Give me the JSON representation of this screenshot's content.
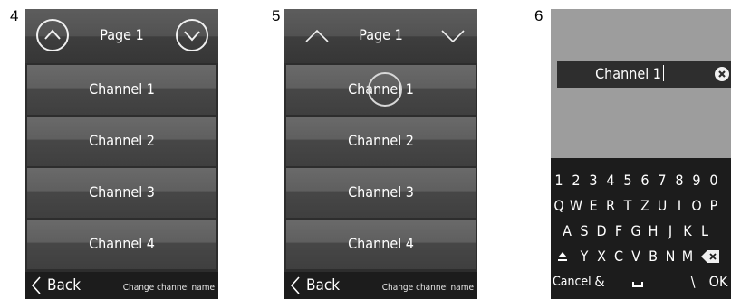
{
  "steps": {
    "first": "4",
    "second": "5",
    "third": "6"
  },
  "channel_screen": {
    "page_title": "Page 1",
    "channels": [
      "Channel 1",
      "Channel 2",
      "Channel 3",
      "Channel 4"
    ],
    "back_label": "Back",
    "footer_hint": "Change channel name",
    "up_icon": "chevron-up-icon",
    "down_icon": "chevron-down-icon"
  },
  "keyboard_screen": {
    "field_value": "Channel 1",
    "clear_icon": "clear-icon",
    "rows": [
      [
        "1",
        "2",
        "3",
        "4",
        "5",
        "6",
        "7",
        "8",
        "9",
        "0"
      ],
      [
        "Q",
        "W",
        "E",
        "R",
        "T",
        "Z",
        "U",
        "I",
        "O",
        "P"
      ],
      [
        "A",
        "S",
        "D",
        "F",
        "G",
        "H",
        "J",
        "K",
        "L"
      ],
      [
        "Y",
        "X",
        "C",
        "V",
        "B",
        "N",
        "M"
      ]
    ],
    "shift_icon": "shift-icon",
    "backspace_icon": "backspace-icon",
    "cancel_label": "Cancel",
    "amp_label": "&",
    "space_icon": "space-bar-icon",
    "backslash_label": "\\",
    "ok_label": "OK"
  },
  "colors": {
    "screen_bg": "#2d2d2d",
    "keyboard_top": "#9d9d9d",
    "footer": "#1c1c1c",
    "text": "#ffffff"
  }
}
